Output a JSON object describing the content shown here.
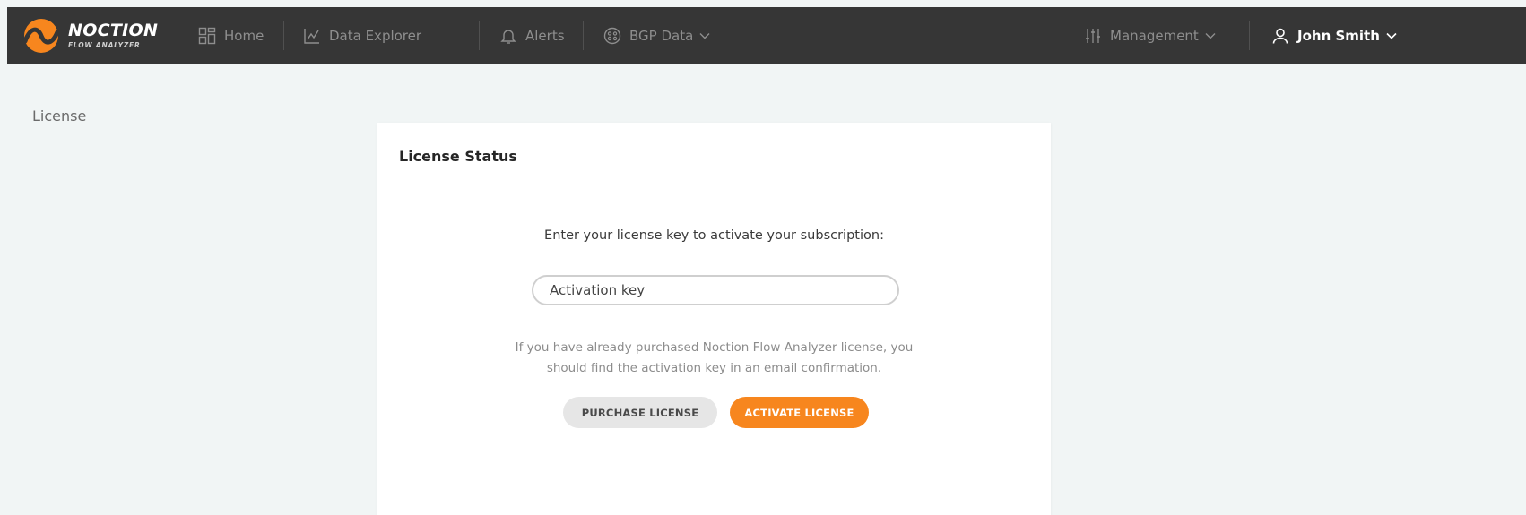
{
  "brand": {
    "title": "NOCTION",
    "subtitle": "FLOW ANALYZER",
    "accent_color": "#f7861e",
    "nav_bg": "#363636"
  },
  "nav": {
    "home": {
      "label": "Home",
      "icon": "grid-icon"
    },
    "data_explorer": {
      "label": "Data Explorer",
      "icon": "chart-line-icon"
    },
    "alerts": {
      "label": "Alerts",
      "icon": "bell-icon"
    },
    "bgp_data": {
      "label": "BGP Data",
      "icon": "network-icon"
    },
    "management": {
      "label": "Management",
      "icon": "sliders-icon"
    },
    "user": {
      "label": "John Smith",
      "icon": "user-icon"
    }
  },
  "breadcrumb": "License",
  "card": {
    "title": "License Status",
    "prompt": "Enter your license key to activate your subscription:",
    "input_placeholder": "Activation key",
    "hint_line1": "If you have already purchased Noction Flow Analyzer license, you",
    "hint_line2": "should find the activation key in an email confirmation.",
    "purchase_label": "PURCHASE LICENSE",
    "activate_label": "ACTIVATE LICENSE"
  }
}
